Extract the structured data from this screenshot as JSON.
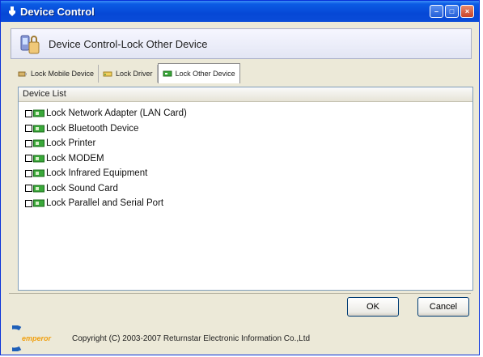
{
  "window": {
    "title": "Device Control",
    "min_label": "–",
    "max_label": "□",
    "close_label": "×"
  },
  "header": {
    "title": "Device Control-Lock Other Device"
  },
  "tabs": [
    {
      "label": "Lock Mobile Device",
      "active": false
    },
    {
      "label": "Lock Driver",
      "active": false
    },
    {
      "label": "Lock Other Device",
      "active": true
    }
  ],
  "device_list": {
    "header": "Device List",
    "items": [
      {
        "label": "Lock Network Adapter (LAN Card)",
        "checked": false
      },
      {
        "label": "Lock Bluetooth Device",
        "checked": false
      },
      {
        "label": "Lock Printer",
        "checked": false
      },
      {
        "label": "Lock MODEM",
        "checked": false
      },
      {
        "label": "Lock Infrared Equipment",
        "checked": false
      },
      {
        "label": "Lock Sound Card",
        "checked": false
      },
      {
        "label": "Lock Parallel and Serial Port",
        "checked": false
      }
    ]
  },
  "buttons": {
    "ok": "OK",
    "cancel": "Cancel"
  },
  "footer": {
    "copyright": "Copyright (C) 2003-2007 Returnstar Electronic Information Co.,Ltd",
    "logo_text": "emperor"
  },
  "colors": {
    "titlebar": "#0648d6",
    "window_bg": "#ece9d8",
    "device_icon": "#3aa83a"
  }
}
